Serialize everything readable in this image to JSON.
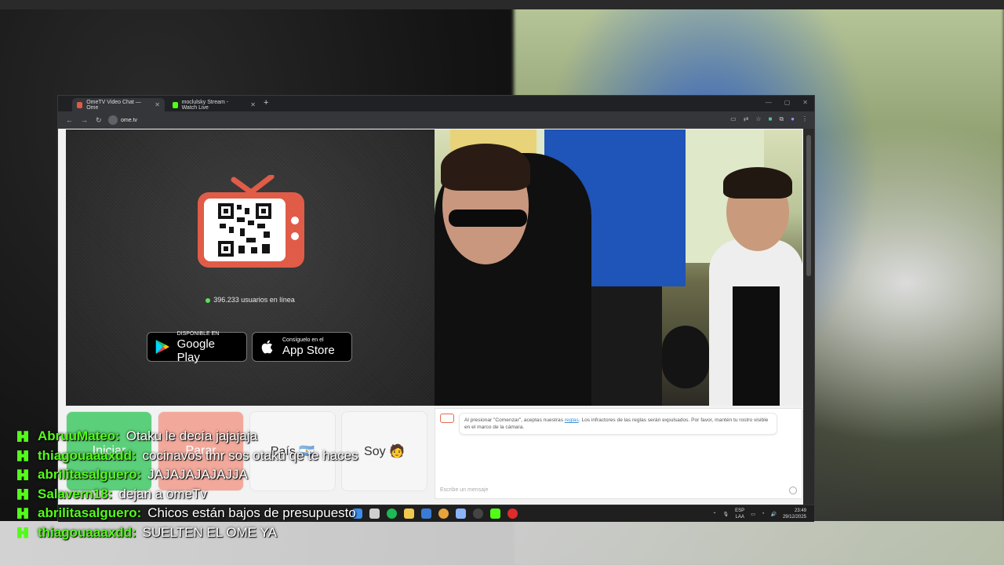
{
  "browser": {
    "tabs": [
      {
        "title": "OmeTV Video Chat — Ome",
        "active": true
      },
      {
        "title": "moclulsky Stream - Watch Live",
        "active": false
      }
    ],
    "url": "ome.tv"
  },
  "ometv": {
    "users_online": "396.233 usuarios en línea",
    "google_play": {
      "small": "DISPONIBLE EN",
      "big": "Google Play"
    },
    "app_store": {
      "small": "Consíguelo en el",
      "big": "App Store"
    },
    "buttons": {
      "start": "Iniciar",
      "stop": "Parar",
      "country": "País 🇦🇷",
      "gender": "Soy 🧑"
    },
    "chat": {
      "notice_before": "Al presionar \"Comenzar\", aceptas nuestras ",
      "notice_link": "reglas",
      "notice_after": ". Los infractores de las reglas serán expulsados. Por favor, mantén tu rostro visible en el marco de la cámara.",
      "input_placeholder": "Escribe un mensaje"
    }
  },
  "taskbar": {
    "lang_top": "ESP",
    "lang_bottom": "LAA",
    "time": "23:49",
    "date": "29/12/2025"
  },
  "stream_chat": [
    {
      "user": "AbruuMateo:",
      "text": "Otaku le decía jajajaja"
    },
    {
      "user": "thiagouaaaxdd:",
      "text": "cocinavos tmr sos otaku qe te haces"
    },
    {
      "user": "abrilitasalguero:",
      "text": "JAJAJAJAJAJJA"
    },
    {
      "user": "Salavern18:",
      "text": "dejan a omeTv"
    },
    {
      "user": "abrilitasalguero:",
      "text": "Chicos están bajos de presupuesto"
    },
    {
      "user": "thiagouaaaxdd:",
      "text": "SUELTEN EL OME YA"
    }
  ],
  "colors": {
    "ome_red": "#e05a45",
    "start_green": "#5ccf7a",
    "stop_red": "#f2a99b",
    "kick_green": "#53fc18"
  }
}
